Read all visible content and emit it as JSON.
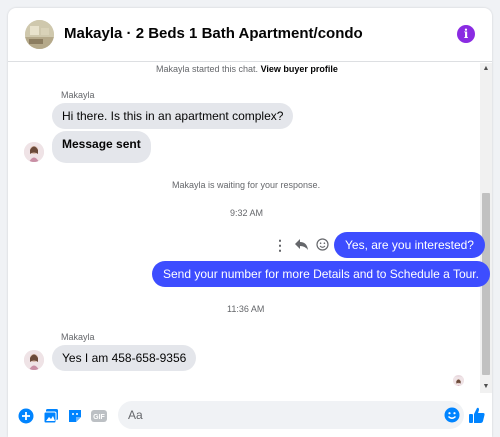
{
  "header": {
    "title": "Makayla · 2 Beds 1 Bath Apartment/condo",
    "info_icon": "info-icon",
    "info_glyph": "i"
  },
  "thread": {
    "started_prefix": "Makayla started this chat.",
    "view_profile": "View buyer profile",
    "sender_name_1": "Makayla",
    "msg_1": "Hi there. Is this in an apartment complex?",
    "msg_2": "Message sent",
    "waiting_note": "Makayla is waiting for your response.",
    "time_1": "9:32 AM",
    "msg_3": "Yes, are you interested?",
    "msg_4": "Send your number for more Details and to Schedule a Tour.",
    "time_2": "11:36 AM",
    "sender_name_2": "Makayla",
    "msg_5": "Yes I am 458-658-9356"
  },
  "composer": {
    "placeholder": "Aa",
    "icons": [
      "plus-circle-icon",
      "photo-icon",
      "sticker-icon",
      "gif-icon",
      "emoji-icon",
      "thumbs-up-icon"
    ],
    "gif_label": "GIF"
  },
  "colors": {
    "accent": "#0084ff",
    "outgoing_bubble": "#3d4dff",
    "incoming_bubble": "#e4e6eb",
    "info_button": "#8a2be2"
  }
}
